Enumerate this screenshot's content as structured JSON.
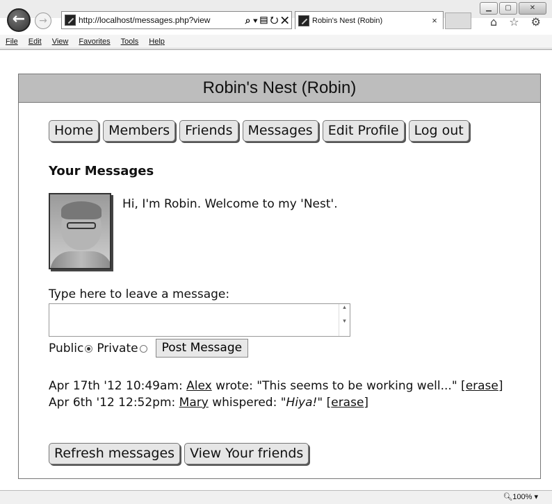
{
  "browser": {
    "url": "http://localhost/messages.php?view",
    "tab_title": "Robin's Nest (Robin)",
    "tab_close": "×",
    "addr_tools": "⌕ ▾ ▤ ↻ ✕",
    "toolbar_icons": "⌂ ☆ ⚙",
    "menu": [
      "File",
      "Edit",
      "View",
      "Favorites",
      "Tools",
      "Help"
    ],
    "zoom": "🔍︎100%  ▾"
  },
  "page": {
    "header": "Robin's Nest (Robin)",
    "nav": [
      "Home",
      "Members",
      "Friends",
      "Messages",
      "Edit Profile",
      "Log out"
    ],
    "heading": "Your Messages",
    "welcome": "Hi, I'm Robin. Welcome to my 'Nest'.",
    "type_prompt": "Type here to leave a message:",
    "public_label": "Public",
    "private_label": "Private",
    "post_button": "Post Message",
    "messages": [
      {
        "time": "Apr 17th '12 10:49am:",
        "author": "Alex",
        "verb": "wrote:",
        "text": "\"This seems to be working well...\"",
        "erase": "erase"
      },
      {
        "time": "Apr 6th '12 12:52pm:",
        "author": "Mary",
        "verb": "whispered:",
        "text": "\"Hiya!\"",
        "erase": "erase"
      }
    ],
    "refresh_button": "Refresh messages",
    "friends_button": "View Your friends"
  }
}
